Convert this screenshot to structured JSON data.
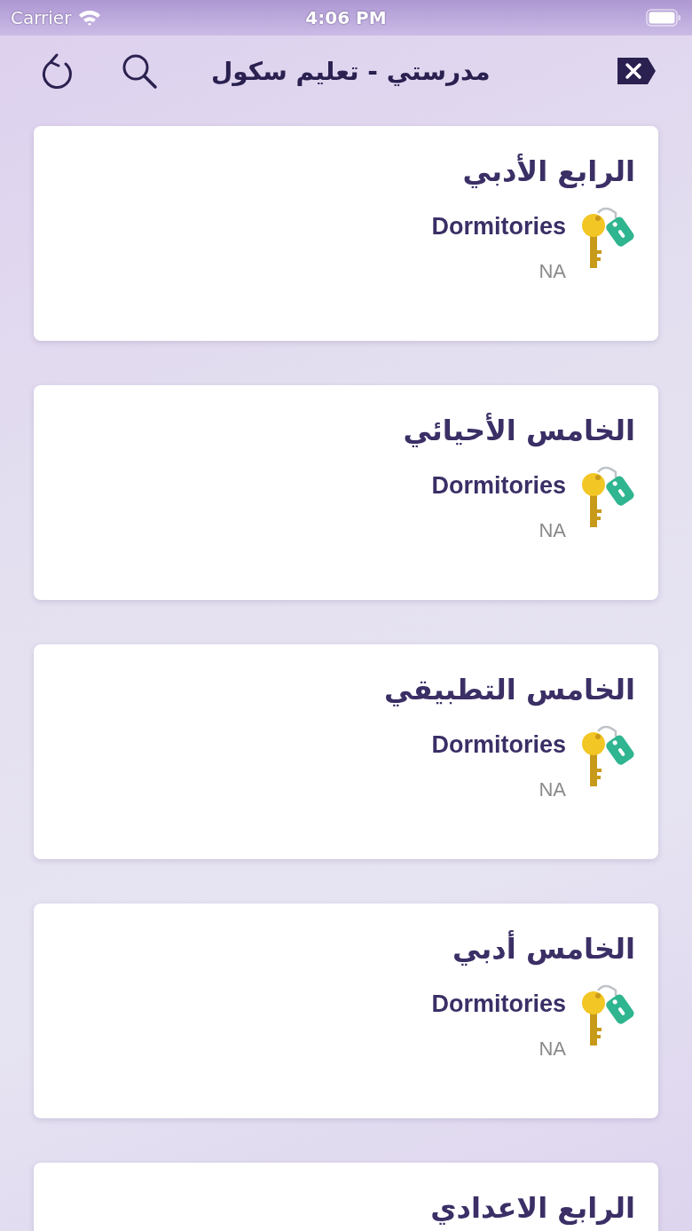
{
  "status_bar": {
    "carrier": "Carrier",
    "time": "4:06 PM"
  },
  "header": {
    "title": "مدرستي - تعليم سكول"
  },
  "cards": [
    {
      "title": "الرابع الأدبي",
      "category": "Dormitories",
      "value": "NA"
    },
    {
      "title": "الخامس الأحيائي",
      "category": "Dormitories",
      "value": "NA"
    },
    {
      "title": "الخامس التطبيقي",
      "category": "Dormitories",
      "value": "NA"
    },
    {
      "title": "الخامس أدبي",
      "category": "Dormitories",
      "value": "NA"
    },
    {
      "title": "الرابع الاعدادي"
    }
  ]
}
